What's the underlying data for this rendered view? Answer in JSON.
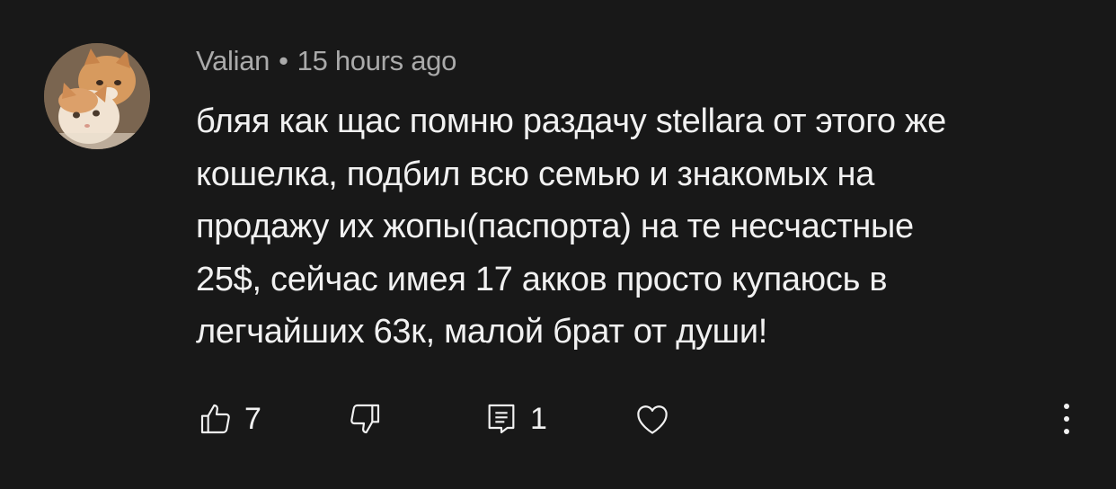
{
  "comment": {
    "author": "Valian",
    "separator": "•",
    "time": "15 hours ago",
    "text": "бляя как щас помню раздачу stellara от этого же\nкошелка, подбил всю семью и знакомых на\nпродажу их жопы(паспорта) на те несчастные\n25$, сейчас имея 17 акков просто купаюсь в\nлегчайших 63к, малой брат от души!",
    "avatar_icon": "cat-avatar",
    "actions": {
      "like_icon": "thumbs-up-icon",
      "like_count": "7",
      "dislike_icon": "thumbs-down-icon",
      "reply_icon": "reply-icon",
      "reply_count": "1",
      "heart_icon": "heart-icon",
      "more_icon": "more-vertical-icon"
    }
  },
  "colors": {
    "background": "#181818",
    "text": "#f1f1f1",
    "meta": "#aaaaaa"
  }
}
